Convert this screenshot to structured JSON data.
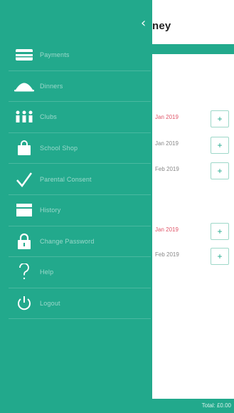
{
  "app": {
    "title_partial": "ney",
    "rows": [
      {
        "date": "Jan 2019",
        "highlight": true,
        "add": "+"
      },
      {
        "date": "Jan 2019",
        "highlight": false,
        "add": "+"
      },
      {
        "date": "Feb 2019",
        "highlight": false,
        "add": "+"
      },
      {
        "date": "Jan 2019",
        "highlight": true,
        "add": "+"
      },
      {
        "date": "Feb 2019",
        "highlight": false,
        "add": "+"
      }
    ],
    "footer_total": "Total: £0.00"
  },
  "drawer": {
    "back_icon": "chevron-left-icon",
    "back_glyph": "‹",
    "items": [
      {
        "label": "Payments",
        "icon": "payments-icon"
      },
      {
        "label": "Dinners",
        "icon": "dinners-icon"
      },
      {
        "label": "Clubs",
        "icon": "clubs-icon"
      },
      {
        "label": "School Shop",
        "icon": "shopping-bag-icon"
      },
      {
        "label": "Parental Consent",
        "icon": "checkmark-icon"
      },
      {
        "label": "History",
        "icon": "history-icon"
      },
      {
        "label": "Change Password",
        "icon": "lock-icon"
      },
      {
        "label": "Help",
        "icon": "question-icon"
      },
      {
        "label": "Logout",
        "icon": "power-icon"
      }
    ]
  },
  "colors": {
    "teal": "#22a98c",
    "highlight_red": "#e0576a"
  }
}
